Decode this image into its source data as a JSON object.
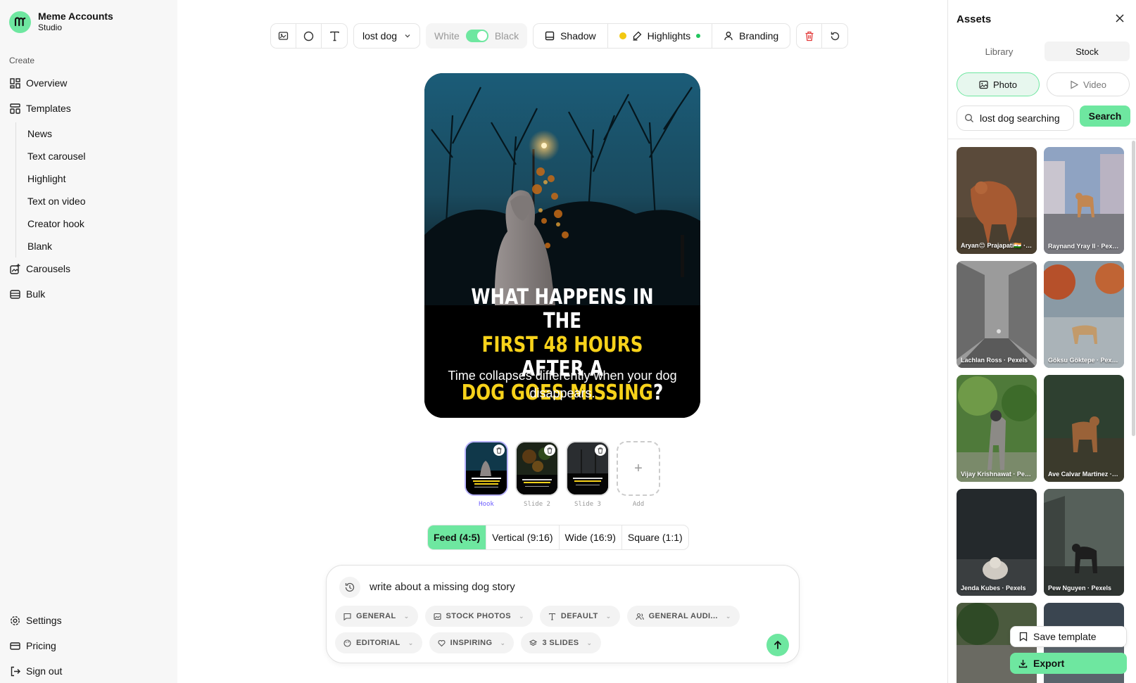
{
  "brand": {
    "name": "Meme Accounts",
    "subtitle": "Studio"
  },
  "sidebar": {
    "section_label": "Create",
    "items": [
      {
        "label": "Overview",
        "icon": "grid-icon"
      },
      {
        "label": "Templates",
        "icon": "layout-icon"
      }
    ],
    "template_items": [
      "News",
      "Text carousel",
      "Highlight",
      "Text on video",
      "Creator hook",
      "Blank"
    ],
    "items2": [
      {
        "label": "Carousels",
        "icon": "image-plus-icon"
      },
      {
        "label": "Bulk",
        "icon": "table-icon"
      }
    ],
    "bottom": [
      {
        "label": "Settings",
        "icon": "gear-icon"
      },
      {
        "label": "Pricing",
        "icon": "credit-card-icon"
      },
      {
        "label": "Sign out",
        "icon": "sign-out-icon"
      }
    ]
  },
  "toolbar": {
    "topic_select": "lost dog",
    "toggle_left": "White",
    "toggle_right": "Black",
    "shadow": "Shadow",
    "highlights": "Highlights",
    "branding": "Branding",
    "colors": {
      "accent": "#6ee7a0",
      "highlight_dot": "#f2c811",
      "delete": "#e23b3b"
    }
  },
  "canvas": {
    "headline_1": "WHAT HAPPENS IN THE",
    "headline_2a": "FIRST 48 HOURS",
    "headline_2b": " AFTER A",
    "headline_3a": "DOG GOES MISSING",
    "headline_3b": "?",
    "subtext": "Time collapses differently when your dog disappears.",
    "highlight_color": "#f7d21a"
  },
  "slides": [
    {
      "label": "Hook",
      "active": true
    },
    {
      "label": "Slide 2",
      "active": false
    },
    {
      "label": "Slide 3",
      "active": false
    }
  ],
  "add_slide_label": "Add",
  "aspect_options": [
    "Feed (4:5)",
    "Vertical (9:16)",
    "Wide (16:9)",
    "Square (1:1)"
  ],
  "aspect_selected": "Feed (4:5)",
  "prompt": {
    "text": "write about a missing dog story",
    "chips_row1": [
      "GENERAL",
      "STOCK PHOTOS",
      "DEFAULT",
      "GENERAL AUDI..."
    ],
    "chips_row2": [
      "EDITORIAL",
      "INSPIRING",
      "3 SLIDES"
    ]
  },
  "assets": {
    "title": "Assets",
    "tabs": [
      "Library",
      "Stock"
    ],
    "tab_selected": "Stock",
    "media_types": [
      "Photo",
      "Video"
    ],
    "media_selected": "Photo",
    "search_value": "lost dog searching",
    "search_button": "Search",
    "photos": [
      {
        "credit": "Aryan😊 Prajapati🇮🇳 · Pexels"
      },
      {
        "credit": "Raynand Yray II · Pexels"
      },
      {
        "credit": "Lachlan Ross · Pexels"
      },
      {
        "credit": "Göksu Göktepe · Pexels"
      },
      {
        "credit": "Vijay Krishnawat · Pexels"
      },
      {
        "credit": "Ave Calvar Martinez · Pexels"
      },
      {
        "credit": "Jenda Kubes · Pexels"
      },
      {
        "credit": "Pew Nguyen · Pexels"
      }
    ],
    "save_template": "Save template",
    "export": "Export"
  }
}
